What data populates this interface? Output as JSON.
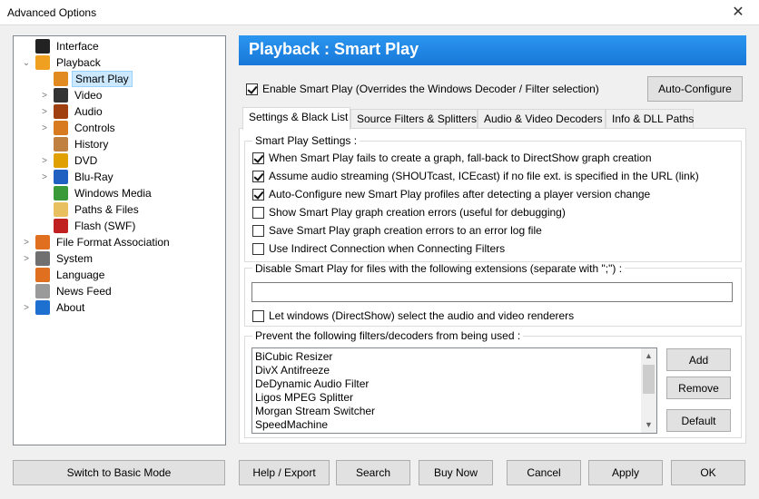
{
  "window": {
    "title": "Advanced Options",
    "close_glyph": "✕"
  },
  "tree": [
    {
      "label": "Interface",
      "expander": "",
      "icon": "interface-icon",
      "color": "#222222"
    },
    {
      "label": "Playback",
      "expander": "⌄",
      "icon": "playback-icon",
      "color": "#f0a020"
    },
    {
      "label": "Smart Play",
      "expander": "",
      "icon": "smart-play-icon",
      "color": "#e08a20",
      "selected": true
    },
    {
      "label": "Video",
      "expander": ">",
      "icon": "video-icon",
      "color": "#333333"
    },
    {
      "label": "Audio",
      "expander": ">",
      "icon": "audio-icon",
      "color": "#a04010"
    },
    {
      "label": "Controls",
      "expander": ">",
      "icon": "controls-icon",
      "color": "#d87a20"
    },
    {
      "label": "History",
      "expander": "",
      "icon": "history-icon",
      "color": "#c08040"
    },
    {
      "label": "DVD",
      "expander": ">",
      "icon": "dvd-icon",
      "color": "#e0a000"
    },
    {
      "label": "Blu-Ray",
      "expander": ">",
      "icon": "bluray-icon",
      "color": "#2060c0"
    },
    {
      "label": "Windows Media",
      "expander": "",
      "icon": "windows-media-icon",
      "color": "#3a9a3a"
    },
    {
      "label": "Paths & Files",
      "expander": "",
      "icon": "folder-icon",
      "color": "#e8c060"
    },
    {
      "label": "Flash (SWF)",
      "expander": "",
      "icon": "flash-icon",
      "color": "#c02020"
    },
    {
      "label": "File Format Association",
      "expander": ">",
      "icon": "file-format-icon",
      "color": "#e07020"
    },
    {
      "label": "System",
      "expander": ">",
      "icon": "system-gear-icon",
      "color": "#707070"
    },
    {
      "label": "Language",
      "expander": "",
      "icon": "language-icon",
      "color": "#e07020"
    },
    {
      "label": "News Feed",
      "expander": "",
      "icon": "news-icon",
      "color": "#9a9a9a"
    },
    {
      "label": "About",
      "expander": ">",
      "icon": "info-icon",
      "color": "#1e70d0"
    }
  ],
  "header": {
    "title": "Playback : Smart Play",
    "color": "#1e7fe0"
  },
  "enable_smart_play": {
    "label": "Enable Smart Play (Overrides the Windows Decoder / Filter selection)",
    "checked": true
  },
  "auto_configure_label": "Auto-Configure",
  "tabs": [
    {
      "label": "Settings & Black List",
      "active": true
    },
    {
      "label": "Source Filters & Splitters"
    },
    {
      "label": "Audio & Video Decoders"
    },
    {
      "label": "Info & DLL Paths"
    }
  ],
  "settings_group": {
    "label": "Smart Play Settings :",
    "options": [
      {
        "label": "When Smart Play fails to create a graph, fall-back to DirectShow graph creation",
        "checked": true
      },
      {
        "label": "Assume audio streaming (SHOUTcast, ICEcast) if no file ext. is specified in the URL (link)",
        "checked": true
      },
      {
        "label": "Auto-Configure new Smart Play profiles after detecting a player version change",
        "checked": true
      },
      {
        "label": "Show Smart Play graph creation errors (useful for debugging)",
        "checked": false
      },
      {
        "label": "Save Smart Play graph creation errors to an error log file",
        "checked": false
      },
      {
        "label": "Use Indirect Connection when Connecting Filters",
        "checked": false
      }
    ]
  },
  "extensions_group": {
    "label": "Disable Smart Play for files with the following extensions (separate with \";\") :",
    "value": "",
    "renderers_label": "Let windows (DirectShow) select the audio and video renderers",
    "renderers_checked": false
  },
  "filters_group": {
    "label": "Prevent the following filters/decoders from being used :",
    "items": [
      "BiCubic Resizer",
      "DivX Antifreeze",
      "DeDynamic Audio Filter",
      "Ligos MPEG Splitter",
      "Morgan Stream Switcher",
      "SpeedMachine"
    ],
    "add_label": "Add",
    "remove_label": "Remove",
    "default_label": "Default"
  },
  "footer": {
    "basic_mode": "Switch to Basic Mode",
    "help_export": "Help / Export",
    "search": "Search",
    "buy_now": "Buy Now",
    "cancel": "Cancel",
    "apply": "Apply",
    "ok": "OK"
  }
}
